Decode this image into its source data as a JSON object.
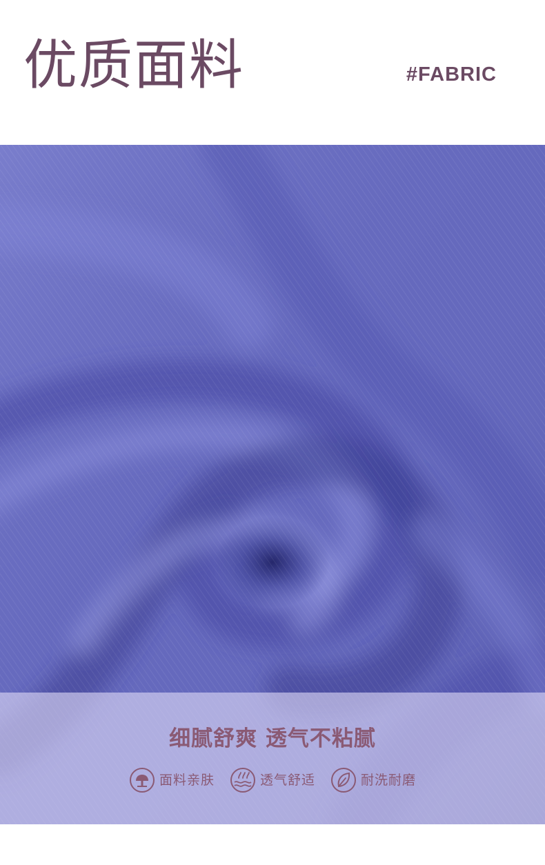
{
  "header": {
    "title": "优质面料",
    "tag": "#FABRIC"
  },
  "caption": {
    "headline": "细腻舒爽 透气不粘腻",
    "features": [
      {
        "icon": "tree-icon",
        "label": "面料亲肤"
      },
      {
        "icon": "breathable-waves-icon",
        "label": "透气舒适"
      },
      {
        "icon": "leaf-icon",
        "label": "耐洗耐磨"
      }
    ]
  },
  "colors": {
    "brand": "#6b4a63",
    "accent": "#8a5a74",
    "fabric": "#6569bd",
    "caption_overlay": "#ddd8f6"
  }
}
